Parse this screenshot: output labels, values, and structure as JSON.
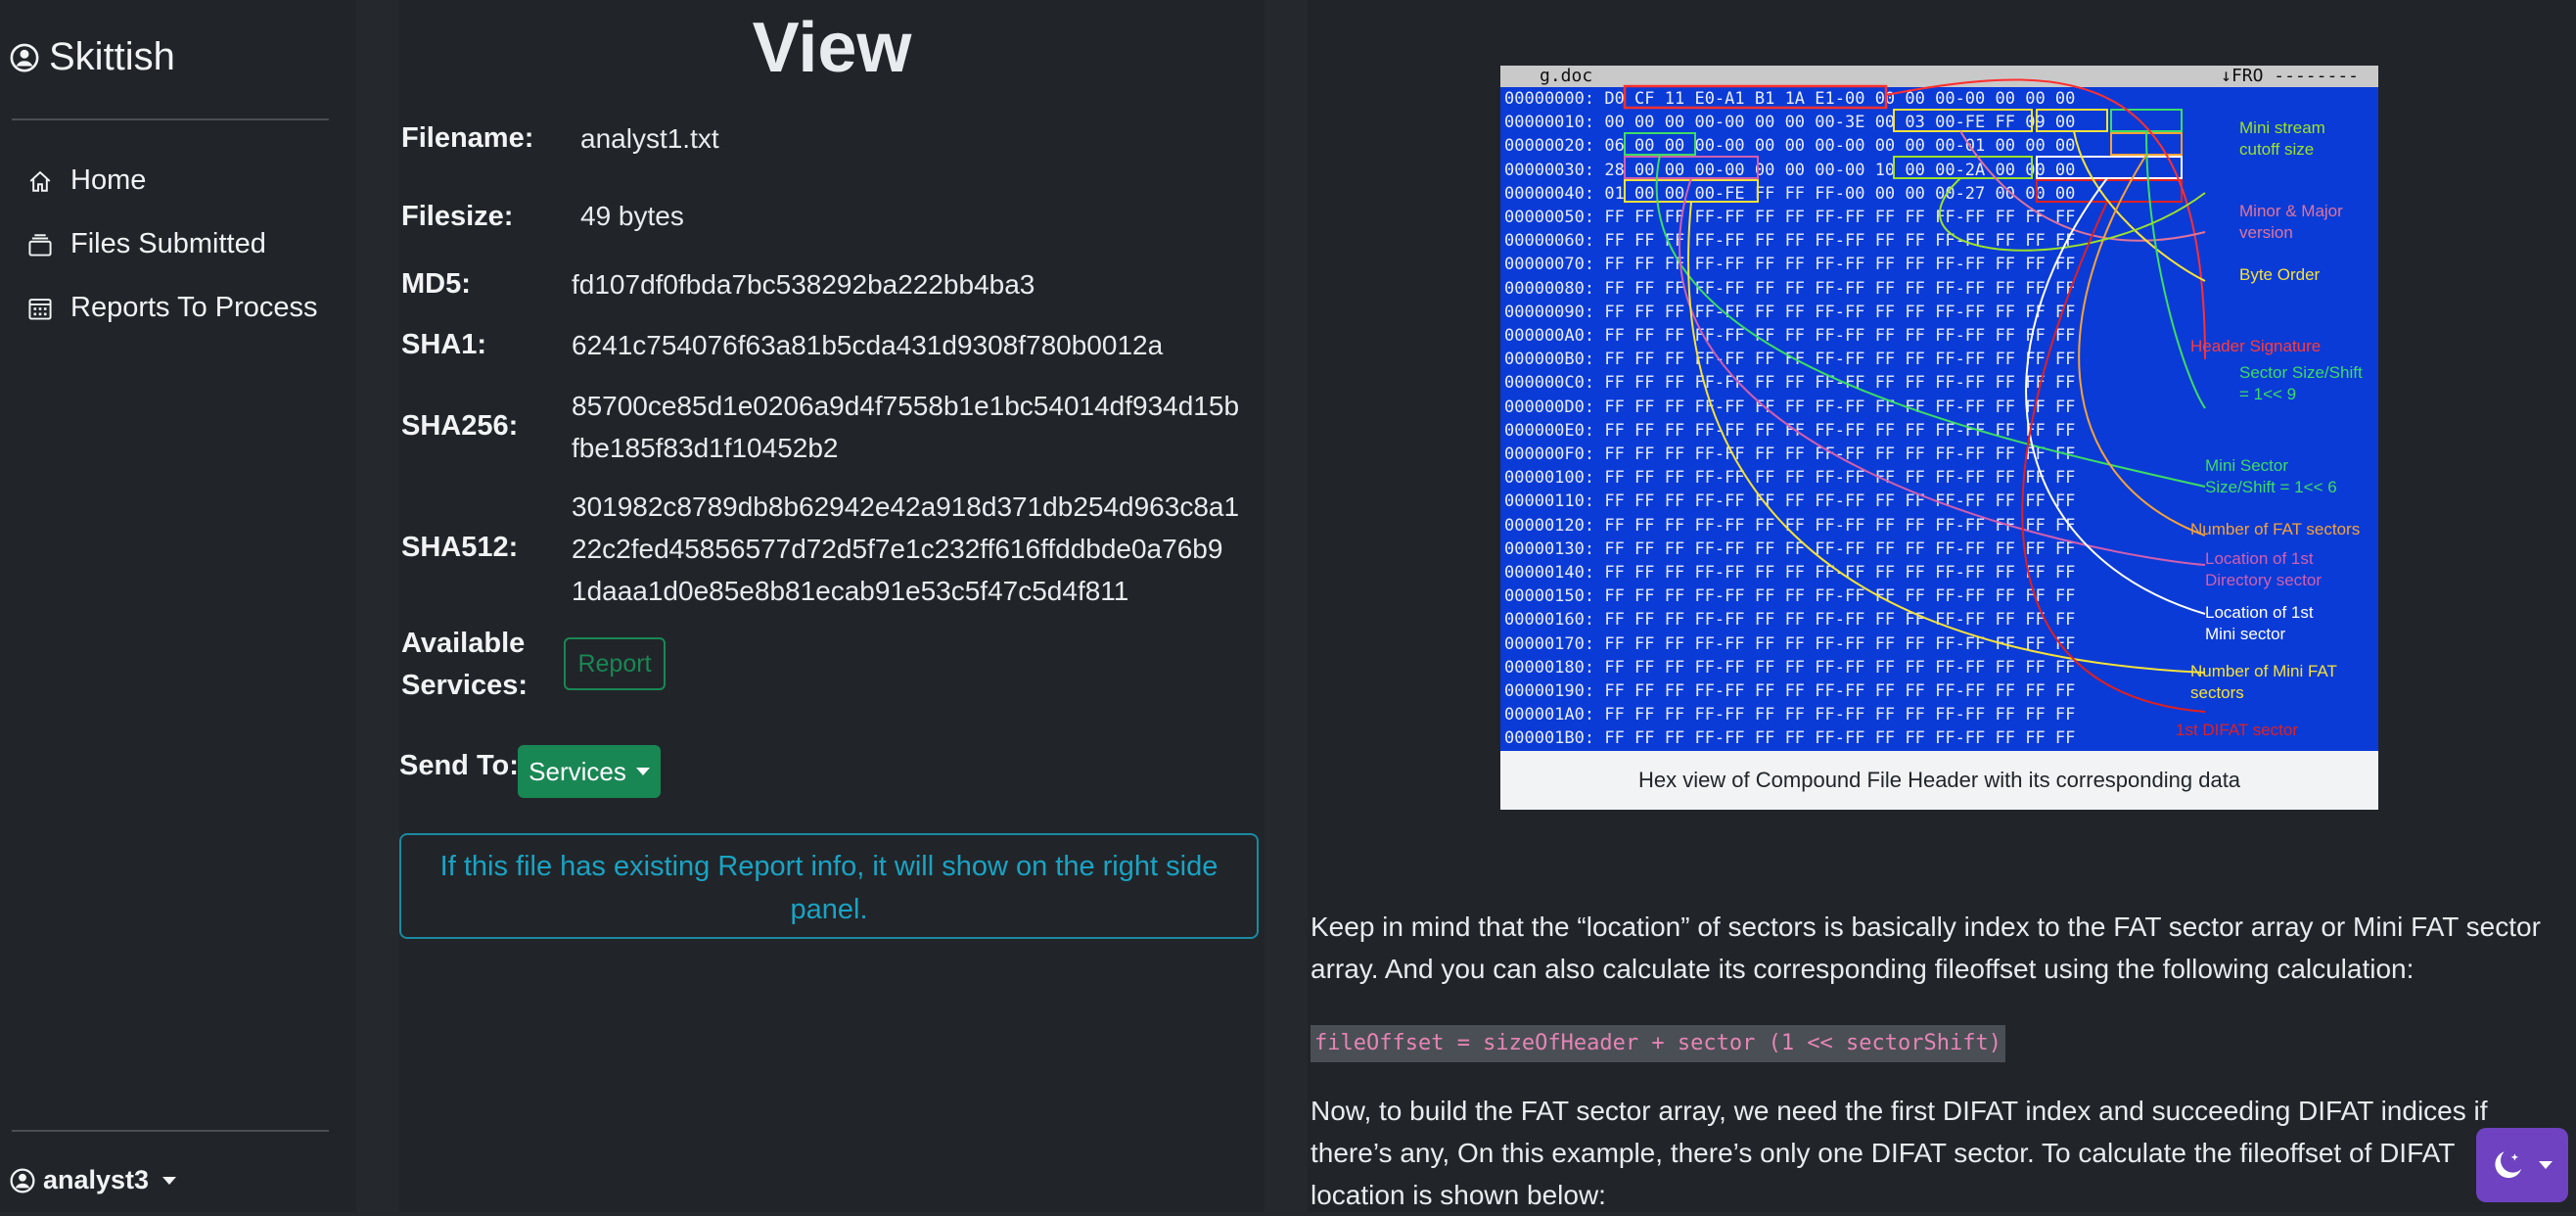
{
  "brand": "Skittish",
  "nav": {
    "home": "Home",
    "files_submitted": "Files Submitted",
    "reports_to_process": "Reports To Process"
  },
  "user": "analyst3",
  "view": {
    "title": "View",
    "filename_label": "Filename",
    "filename": "analyst1.txt",
    "filesize_label": "Filesize",
    "filesize": "49 bytes",
    "md5_label": "MD5",
    "md5": "fd107df0fbda7bc538292ba222bb4ba3",
    "sha1_label": "SHA1",
    "sha1": "6241c754076f63a81b5cda431d9308f780b0012a",
    "sha256_label": "SHA256",
    "sha256_line1": "85700ce85d1e0206a9d4f7558b1e1bc54014df934d15b",
    "sha256_line2": "fbe185f83d1f10452b2",
    "sha512_label": "SHA512",
    "sha512_line1": "301982c8789db8b62942e42a918d371db254d963c8a1",
    "sha512_line2": "22c2fed45856577d72d5f7e1c232ff616ffddbde0a76b9",
    "sha512_line3": "1daaa1d0e85e8b81ecab91e53c5f47c5d4f811",
    "services_label_1": "Available",
    "services_label_2": "Services",
    "report_button": "Report",
    "send_to_label": "Send To",
    "services_button": "Services",
    "info_line1": "If this file has existing Report info, it will show on the right side",
    "info_line2": "panel."
  },
  "article": {
    "hex_header_left": "g.doc",
    "hex_header_right": "↓FRO --------",
    "hex_rows": [
      "00000000: D0 CF 11 E0-A1 B1 1A E1-00 00 00 00-00 00 00 00",
      "00000010: 00 00 00 00-00 00 00 00-3E 00 03 00-FE FF 09 00",
      "00000020: 06 00 00 00-00 00 00 00-00 00 00 00-01 00 00 00",
      "00000030: 28 00 00 00-00 00 00 00-00 10 00 00-2A 00 00 00",
      "00000040: 01 00 00 00-FE FF FF FF-00 00 00 00-27 00 00 00",
      "00000050: FF FF FF FF-FF FF FF FF-FF FF FF FF-FF FF FF FF",
      "00000060: FF FF FF FF-FF FF FF FF-FF FF FF FF-FF FF FF FF",
      "00000070: FF FF FF FF-FF FF FF FF-FF FF FF FF-FF FF FF FF",
      "00000080: FF FF FF FF-FF FF FF FF-FF FF FF FF-FF FF FF FF",
      "00000090: FF FF FF FF-FF FF FF FF-FF FF FF FF-FF FF FF FF",
      "000000A0: FF FF FF FF-FF FF FF FF-FF FF FF FF-FF FF FF FF",
      "000000B0: FF FF FF FF-FF FF FF FF-FF FF FF FF-FF FF FF FF",
      "000000C0: FF FF FF FF-FF FF FF FF-FF FF FF FF-FF FF FF FF",
      "000000D0: FF FF FF FF-FF FF FF FF-FF FF FF FF-FF FF FF FF",
      "000000E0: FF FF FF FF-FF FF FF FF-FF FF FF FF-FF FF FF FF",
      "000000F0: FF FF FF FF-FF FF FF FF-FF FF FF FF-FF FF FF FF",
      "00000100: FF FF FF FF-FF FF FF FF-FF FF FF FF-FF FF FF FF",
      "00000110: FF FF FF FF-FF FF FF FF-FF FF FF FF-FF FF FF FF",
      "00000120: FF FF FF FF-FF FF FF FF-FF FF FF FF-FF FF FF FF",
      "00000130: FF FF FF FF-FF FF FF FF-FF FF FF FF-FF FF FF FF",
      "00000140: FF FF FF FF-FF FF FF FF-FF FF FF FF-FF FF FF FF",
      "00000150: FF FF FF FF-FF FF FF FF-FF FF FF FF-FF FF FF FF",
      "00000160: FF FF FF FF-FF FF FF FF-FF FF FF FF-FF FF FF FF",
      "00000170: FF FF FF FF-FF FF FF FF-FF FF FF FF-FF FF FF FF",
      "00000180: FF FF FF FF-FF FF FF FF-FF FF FF FF-FF FF FF FF",
      "00000190: FF FF FF FF-FF FF FF FF-FF FF FF FF-FF FF FF FF",
      "000001A0: FF FF FF FF-FF FF FF FF-FF FF FF FF-FF FF FF FF",
      "000001B0: FF FF FF FF-FF FF FF FF-FF FF FF FF-FF FF FF FF"
    ],
    "annotations": [
      {
        "text": "Mini stream\ncutoff size",
        "color": "#9be22b"
      },
      {
        "text": "Minor & Major\nversion",
        "color": "#e0749a"
      },
      {
        "text": "Byte Order",
        "color": "#f5e23a"
      },
      {
        "text": "Header Signature",
        "color": "#ff3b3b"
      },
      {
        "text": "Sector Size/Shift\n= 1<< 9",
        "color": "#3ddc65"
      },
      {
        "text": "Mini Sector\nSize/Shift = 1<< 6",
        "color": "#3ddc65"
      },
      {
        "text": "Number of FAT sectors",
        "color": "#f5a23a"
      },
      {
        "text": "Location of 1st\nDirectory sector",
        "color": "#d05fb0"
      },
      {
        "text": "Location of 1st\nMini sector",
        "color": "#ffffff"
      },
      {
        "text": "Number of Mini FAT\nsectors",
        "color": "#f5e23a"
      },
      {
        "text": "1st DIFAT sector",
        "color": "#e02020"
      }
    ],
    "caption": "Hex view of Compound File Header with its corresponding data",
    "para1_line1": "Keep in mind that the “location” of sectors is basically index to the FAT sector array or Mini FAT sector",
    "para1_line2": "array. And you can also calculate its corresponding fileoffset using the following calculation:",
    "code": "fileOffset = sizeOfHeader + sector (1 << sectorShift)",
    "para2_line1": "Now, to build the FAT sector array, we need the first DIFAT index and succeeding DIFAT indices if",
    "para2_line2": "there’s any, On this example, there’s only one DIFAT sector. To calculate the fileoffset of DIFAT",
    "para2_line3": "location is shown below:"
  },
  "colors": {
    "accent": "#198754",
    "info": "#1aa3c4",
    "theme": "#6f42c1"
  }
}
